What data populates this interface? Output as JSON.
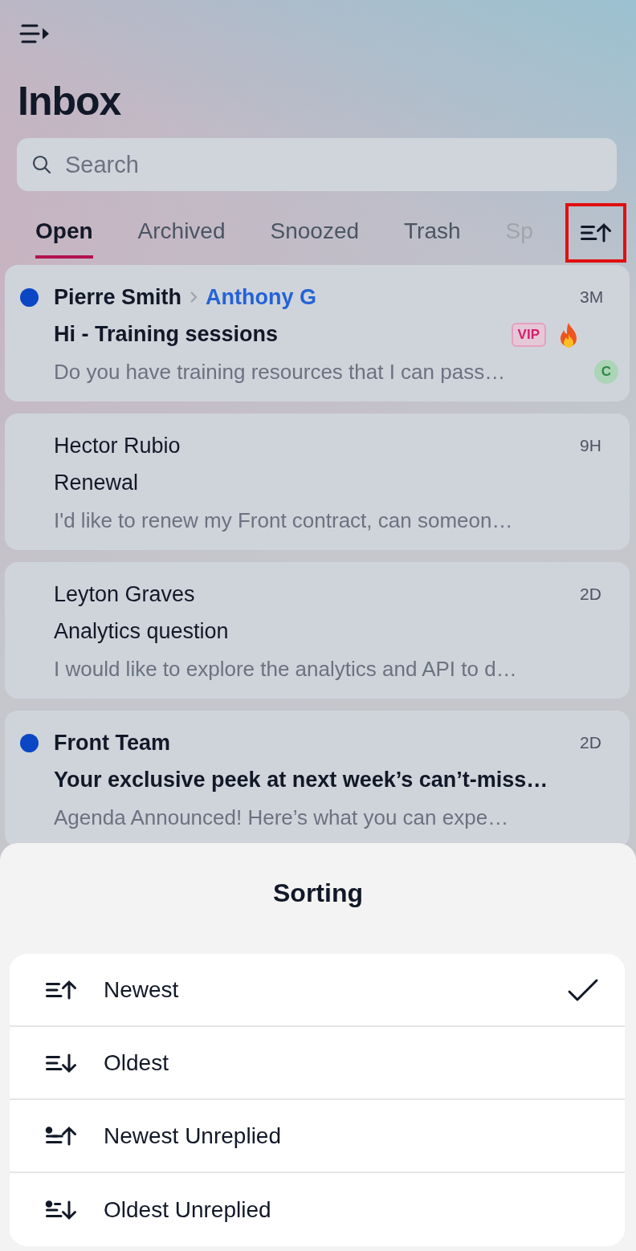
{
  "title": "Inbox",
  "search": {
    "placeholder": "Search"
  },
  "tabs": [
    {
      "label": "Open",
      "selected": true
    },
    {
      "label": "Archived",
      "selected": false
    },
    {
      "label": "Snoozed",
      "selected": false
    },
    {
      "label": "Trash",
      "selected": false
    },
    {
      "label": "Sp",
      "selected": false
    }
  ],
  "sort_button": {
    "highlighted": true
  },
  "conversations": [
    {
      "sender": "Pierre Smith",
      "assignee": "Anthony G",
      "time": "3M",
      "subject": "Hi -  Training sessions",
      "preview": "Do you have training resources that I can pass…",
      "unread": true,
      "tag": "VIP",
      "hot": true,
      "avatar": "C"
    },
    {
      "sender": "Hector Rubio",
      "time": "9H",
      "subject": "Renewal",
      "preview": "I'd like to renew my Front contract, can someon…",
      "unread": false
    },
    {
      "sender": "Leyton Graves",
      "time": "2D",
      "subject": "Analytics question",
      "preview": "I would like to explore the analytics and API to d…",
      "unread": false
    },
    {
      "sender": "Front Team",
      "time": "2D",
      "subject": "Your exclusive peek at next week’s can’t-miss…",
      "preview": "Agenda Announced! Here’s what you can expe…",
      "unread": true
    }
  ],
  "sorting": {
    "title": "Sorting",
    "options": [
      {
        "label": "Newest",
        "kind": "newest",
        "selected": true
      },
      {
        "label": "Oldest",
        "kind": "oldest",
        "selected": false
      },
      {
        "label": "Newest Unreplied",
        "kind": "newest-unreplied",
        "selected": false
      },
      {
        "label": "Oldest Unreplied",
        "kind": "oldest-unreplied",
        "selected": false
      }
    ]
  }
}
